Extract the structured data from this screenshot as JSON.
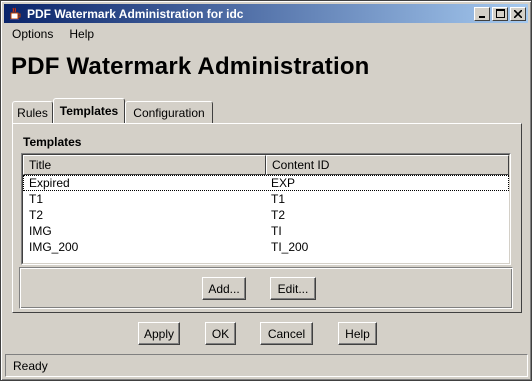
{
  "window": {
    "title": "PDF Watermark Administration for idc"
  },
  "menu": [
    "Options",
    "Help"
  ],
  "page_title": "PDF Watermark Administration",
  "tabs": [
    {
      "label": "Rules"
    },
    {
      "label": "Templates",
      "active": true
    },
    {
      "label": "Configuration"
    }
  ],
  "templates": {
    "group_title": "Templates",
    "columns": [
      "Title",
      "Content ID"
    ],
    "rows": [
      {
        "title": "Expired",
        "content_id": "EXP"
      },
      {
        "title": "T1",
        "content_id": "T1"
      },
      {
        "title": "T2",
        "content_id": "T2"
      },
      {
        "title": "IMG",
        "content_id": "TI"
      },
      {
        "title": "IMG_200",
        "content_id": "TI_200"
      }
    ],
    "add_label": "Add...",
    "edit_label": "Edit..."
  },
  "footer_buttons": {
    "apply": "Apply",
    "ok": "OK",
    "cancel": "Cancel",
    "help": "Help"
  },
  "status": "Ready",
  "colors": {
    "title_bar_start": "#0a246a",
    "title_bar_end": "#a6caf0",
    "window_bg": "#d4d0c8"
  },
  "icons": {
    "app": "java-cup-icon",
    "minimize": "minimize-icon",
    "maximize": "maximize-icon",
    "close": "close-icon"
  }
}
